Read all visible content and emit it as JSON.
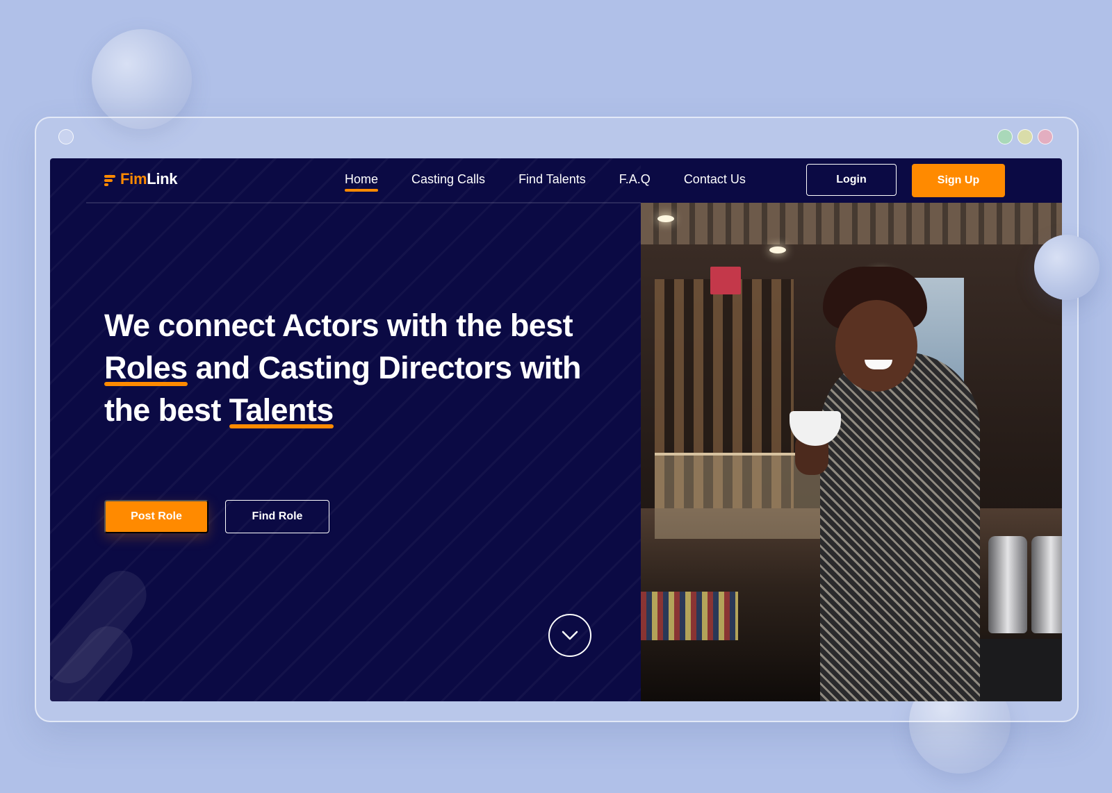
{
  "brand": {
    "part1": "Fim",
    "part2": "Link"
  },
  "nav": {
    "items": [
      {
        "label": "Home",
        "active": true
      },
      {
        "label": "Casting Calls"
      },
      {
        "label": "Find Talents"
      },
      {
        "label": "F.A.Q"
      },
      {
        "label": "Contact Us"
      }
    ]
  },
  "auth": {
    "login_label": "Login",
    "signup_label": "Sign Up"
  },
  "hero": {
    "line1": "We connect Actors with the best",
    "highlight1": "Roles",
    "line2_rest": " and Casting Directors with",
    "line3_pre": "the best ",
    "highlight2": "Talents",
    "post_role_label": "Post Role",
    "find_role_label": "Find Role"
  },
  "icons": {
    "logo": "filmlink-logo-icon",
    "scroll": "chevron-down-icon"
  },
  "colors": {
    "page_bg": "#b0c0e8",
    "site_bg": "#0b0a44",
    "accent": "#ff8a00",
    "text": "#ffffff"
  }
}
